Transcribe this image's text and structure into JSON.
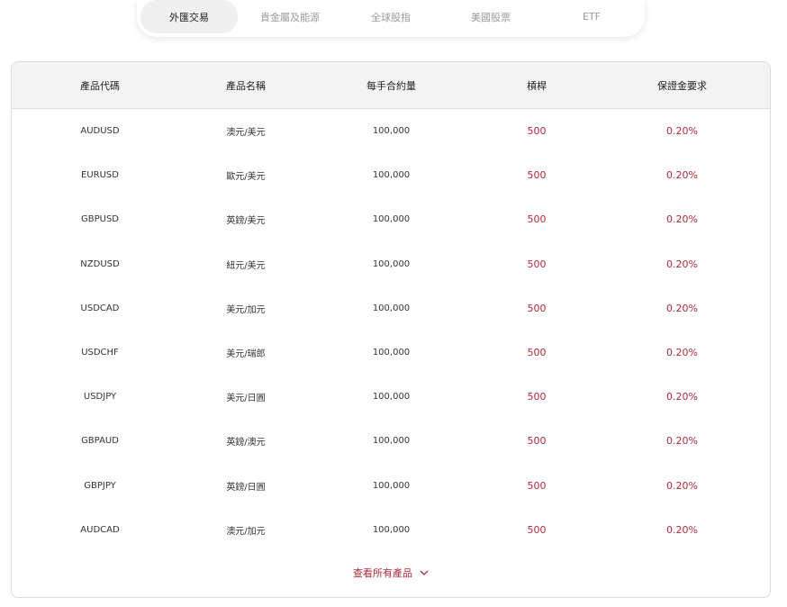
{
  "tabs": [
    {
      "label": "外匯交易",
      "active": true
    },
    {
      "label": "貴金屬及能源",
      "active": false
    },
    {
      "label": "全球股指",
      "active": false
    },
    {
      "label": "美國股票",
      "active": false
    },
    {
      "label": "ETF",
      "active": false
    }
  ],
  "table": {
    "headers": [
      "產品代碼",
      "產品名稱",
      "每手合約量",
      "槓桿",
      "保證金要求"
    ],
    "rows": [
      [
        "AUDUSD",
        "澳元/美元",
        "100,000",
        "500",
        "0.20%"
      ],
      [
        "EURUSD",
        "歐元/美元",
        "100,000",
        "500",
        "0.20%"
      ],
      [
        "GBPUSD",
        "英鎊/美元",
        "100,000",
        "500",
        "0.20%"
      ],
      [
        "NZDUSD",
        "紐元/美元",
        "100,000",
        "500",
        "0.20%"
      ],
      [
        "USDCAD",
        "美元/加元",
        "100,000",
        "500",
        "0.20%"
      ],
      [
        "USDCHF",
        "美元/瑞郎",
        "100,000",
        "500",
        "0.20%"
      ],
      [
        "USDJPY",
        "美元/日圓",
        "100,000",
        "500",
        "0.20%"
      ],
      [
        "GBPAUD",
        "英鎊/澳元",
        "100,000",
        "500",
        "0.20%"
      ],
      [
        "GBPJPY",
        "英鎊/日圓",
        "100,000",
        "500",
        "0.20%"
      ],
      [
        "AUDCAD",
        "澳元/加元",
        "100,000",
        "500",
        "0.20%"
      ]
    ]
  },
  "view_all": {
    "label": "查看所有產品",
    "icon": "chevron-down-icon"
  },
  "colors": {
    "accent": "#b0283a",
    "header_bg": "#f3f3f3",
    "active_tab_bg": "#f0f0f0"
  }
}
